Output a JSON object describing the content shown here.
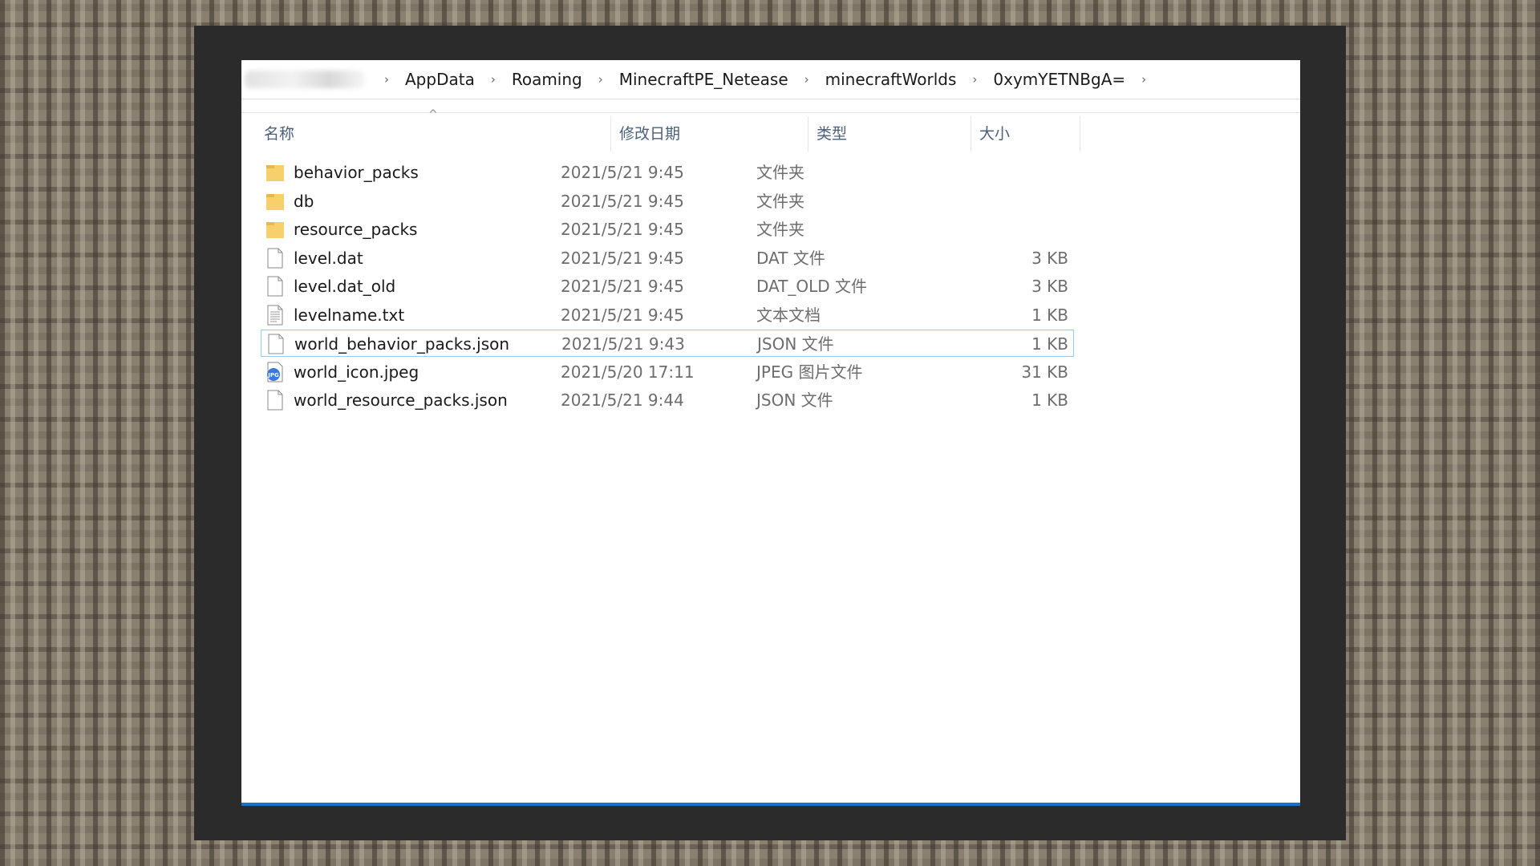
{
  "breadcrumb": {
    "items": [
      "AppData",
      "Roaming",
      "MinecraftPE_Netease",
      "minecraftWorlds",
      "0xymYETNBgA="
    ],
    "separator": "›"
  },
  "columns": {
    "name": "名称",
    "date": "修改日期",
    "type": "类型",
    "size": "大小"
  },
  "files": [
    {
      "name": "behavior_packs",
      "date": "2021/5/21 9:45",
      "type": "文件夹",
      "size": "",
      "icon": "folder-icon"
    },
    {
      "name": "db",
      "date": "2021/5/21 9:45",
      "type": "文件夹",
      "size": "",
      "icon": "folder-icon"
    },
    {
      "name": "resource_packs",
      "date": "2021/5/21 9:45",
      "type": "文件夹",
      "size": "",
      "icon": "folder-icon"
    },
    {
      "name": "level.dat",
      "date": "2021/5/21 9:45",
      "type": "DAT 文件",
      "size": "3 KB",
      "icon": "file-icon"
    },
    {
      "name": "level.dat_old",
      "date": "2021/5/21 9:45",
      "type": "DAT_OLD 文件",
      "size": "3 KB",
      "icon": "file-icon"
    },
    {
      "name": "levelname.txt",
      "date": "2021/5/21 9:45",
      "type": "文本文档",
      "size": "1 KB",
      "icon": "text-file-icon"
    },
    {
      "name": "world_behavior_packs.json",
      "date": "2021/5/21 9:43",
      "type": "JSON 文件",
      "size": "1 KB",
      "icon": "file-icon",
      "selected": true
    },
    {
      "name": "world_icon.jpeg",
      "date": "2021/5/20 17:11",
      "type": "JPEG 图片文件",
      "size": "31 KB",
      "icon": "jpeg-file-icon"
    },
    {
      "name": "world_resource_packs.json",
      "date": "2021/5/21 9:44",
      "type": "JSON 文件",
      "size": "1 KB",
      "icon": "file-icon"
    }
  ],
  "colors": {
    "accent": "#1f6fc4",
    "selection_border": "#99c9ef",
    "folder": "#f7d06b",
    "header_text": "#4c607a"
  }
}
